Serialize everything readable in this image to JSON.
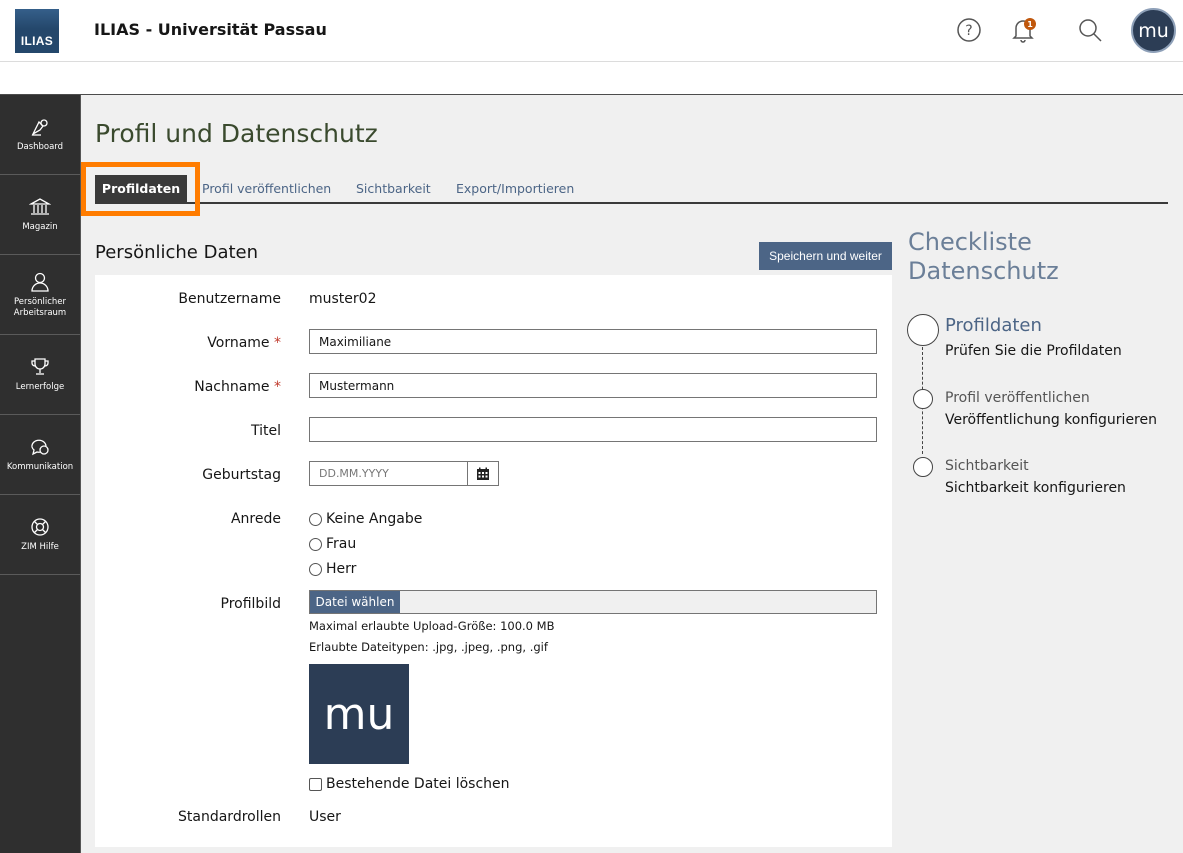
{
  "header": {
    "logo_text": "ILIAS",
    "title": "ILIAS - Universität Passau",
    "icons": [
      "help-icon",
      "notification-bell-icon",
      "search-icon"
    ],
    "notification_count": "1",
    "avatar_initials": "mu"
  },
  "sidebar": {
    "items": [
      {
        "label": "Dashboard",
        "icon": "dashboard-icon"
      },
      {
        "label": "Magazin",
        "icon": "repository-icon"
      },
      {
        "label_line1": "Persönlicher",
        "label_line2": "Arbeitsraum",
        "icon": "person-icon"
      },
      {
        "label": "Lernerfolge",
        "icon": "trophy-icon"
      },
      {
        "label": "Kommunikation",
        "icon": "chat-icon"
      },
      {
        "label": "ZIM Hilfe",
        "icon": "lifebuoy-icon"
      }
    ]
  },
  "main": {
    "page_title": "Profil und Datenschutz",
    "tabs": [
      {
        "label": "Profildaten",
        "active": true
      },
      {
        "label": "Profil veröffentlichen"
      },
      {
        "label": "Sichtbarkeit"
      },
      {
        "label": "Export/Importieren"
      }
    ],
    "highlight_color": "#ff7c00",
    "section_title": "Persönliche Daten",
    "save_button": "Speichern und weiter"
  },
  "form": {
    "username_label": "Benutzername",
    "username_value": "muster02",
    "firstname_label": "Vorname",
    "firstname_value": "Maximiliane",
    "lastname_label": "Nachname",
    "lastname_value": "Mustermann",
    "required_marker": "*",
    "title_label": "Titel",
    "title_value": "",
    "birthday_label": "Geburtstag",
    "birthday_placeholder": "DD.MM.YYYY",
    "salutation_label": "Anrede",
    "salutation_options": [
      "Keine Angabe",
      "Frau",
      "Herr"
    ],
    "picture_label": "Profilbild",
    "file_button": "Datei wählen",
    "max_upload": "Maximal erlaubte Upload-Größe: 100.0 MB",
    "allowed_types": "Erlaubte Dateitypen: .jpg, .jpeg, .png, .gif",
    "picture_initials": "mu",
    "delete_file_label": "Bestehende Datei löschen",
    "roles_label": "Standardrollen",
    "roles_value": "User"
  },
  "checklist": {
    "title": "Checkliste Datenschutz",
    "steps": [
      {
        "title": "Profildaten",
        "desc": "Prüfen Sie die Profildaten"
      },
      {
        "title": "Profil veröffentlichen",
        "desc": "Veröffentlichung konfigurieren"
      },
      {
        "title": "Sichtbarkeit",
        "desc": "Sichtbarkeit konfigurieren"
      }
    ]
  }
}
